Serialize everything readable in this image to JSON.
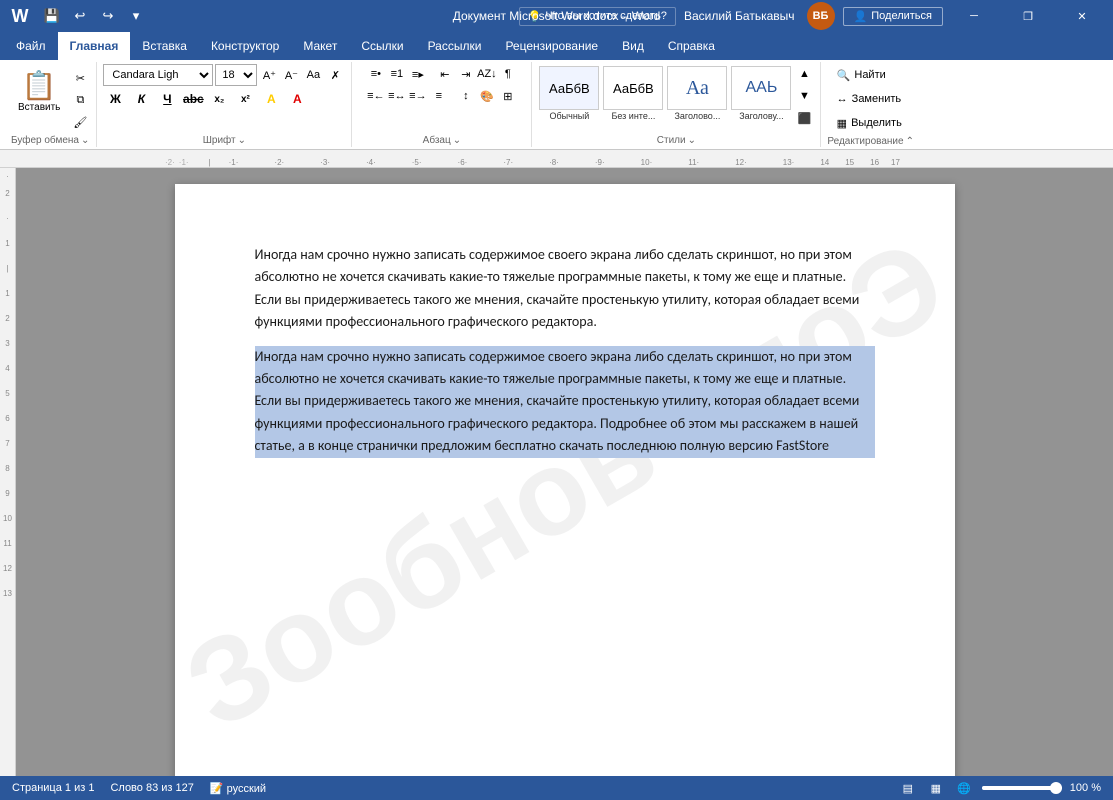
{
  "titlebar": {
    "title": "Документ Microsoft Word.docx  –  Word",
    "user_name": "Василий Батькавыч",
    "user_initials": "ВБ",
    "qat": {
      "save": "💾",
      "undo": "↩",
      "redo": "↪",
      "dropdown": "▾"
    },
    "window_buttons": {
      "minimize": "─",
      "restore": "❐",
      "close": "✕"
    }
  },
  "ribbon": {
    "tabs": [
      {
        "label": "Файл",
        "active": false
      },
      {
        "label": "Главная",
        "active": true
      },
      {
        "label": "Вставка",
        "active": false
      },
      {
        "label": "Конструктор",
        "active": false
      },
      {
        "label": "Макет",
        "active": false
      },
      {
        "label": "Ссылки",
        "active": false
      },
      {
        "label": "Рассылки",
        "active": false
      },
      {
        "label": "Рецензирование",
        "active": false
      },
      {
        "label": "Вид",
        "active": false
      },
      {
        "label": "Справка",
        "active": false
      }
    ],
    "groups": {
      "clipboard": {
        "label": "Буфер обмена",
        "paste_label": "Вставить"
      },
      "font": {
        "label": "Шрифт",
        "font_name": "Candara Ligh",
        "font_size": "18",
        "bold": "Ж",
        "italic": "К",
        "underline": "Ч",
        "strikethrough": "abc",
        "superscript": "x²",
        "subscript": "x₂"
      },
      "paragraph": {
        "label": "Абзац"
      },
      "styles": {
        "label": "Стили",
        "items": [
          {
            "label": "Обычный",
            "preview": "АаБбВ"
          },
          {
            "label": "Без инте...",
            "preview": "АаБбВ"
          },
          {
            "label": "Заголово...",
            "preview": "Аа"
          },
          {
            "label": "Заголову...",
            "preview": "ААЬ"
          }
        ]
      },
      "editing": {
        "label": "Редактирование",
        "find": "Найти",
        "replace": "Заменить",
        "select": "Выделить"
      }
    },
    "tell_me": "Что вы хотите сделать?",
    "share": "Поделиться"
  },
  "document": {
    "paragraph1": "Иногда нам срочно нужно записать содержимое своего экрана либо сделать скриншот, но при этом абсолютно не хочется скачивать какие-то тяжелые программные пакеты, к тому же еще и платные. Если вы придерживаетесь такого же мнения, скачайте простенькую утилиту, которая обладает всеми функциями профессионального графического редактора.",
    "paragraph2": "Иногда нам срочно нужно записать содержимое своего экрана либо сделать скриншот, но при этом абсолютно не хочется скачивать какие-то тяжелые программные пакеты, к тому же еще и платные. Если вы придерживаетесь такого же мнения, скачайте простенькую утилиту, которая обладает всеми функциями профессионального графического редактора. Подробнее об этом мы расскажем в нашей статье, а в конце странички предложим бесплатно скачать последнюю полную версию FastStore",
    "watermark": "Зообнов чпоЭ"
  },
  "statusbar": {
    "page_info": "Страница 1 из 1",
    "words": "Слово 83 из 127",
    "language": "русский",
    "zoom": "100 %",
    "layout_icons": [
      "▤",
      "▦"
    ]
  }
}
